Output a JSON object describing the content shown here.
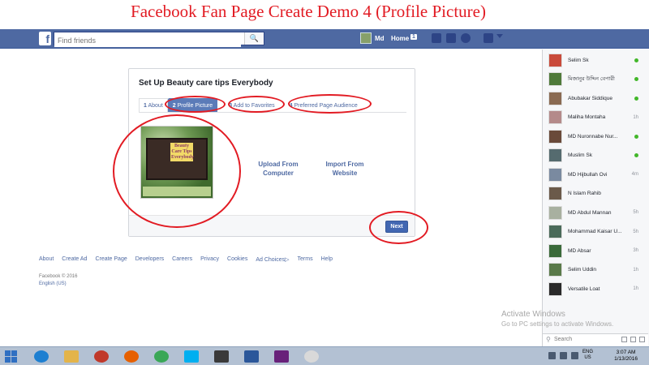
{
  "overlay_title": "Facebook Fan Page Create Demo 4 (Profile Picture)",
  "topbar": {
    "logo": "f",
    "search_placeholder": "Find friends",
    "user_name": "Md",
    "home_label": "Home",
    "home_count": "1"
  },
  "setup_card": {
    "title": "Set Up Beauty care tips Everybody",
    "tabs": [
      {
        "num": "1",
        "label": "About"
      },
      {
        "num": "2",
        "label": "Profile Picture"
      },
      {
        "num": "3",
        "label": "Add to Favorites"
      },
      {
        "num": "4",
        "label": "Preferred Page Audience"
      }
    ],
    "active_tab": 1,
    "picture_text": "Beauty\nCare Tips\nEverybody",
    "upload_label": "Upload From\nComputer",
    "import_label": "Import From\nWebsite",
    "next_label": "Next"
  },
  "footer": {
    "links": [
      "About",
      "Create Ad",
      "Create Page",
      "Developers",
      "Careers",
      "Privacy",
      "Cookies",
      "Ad Choices",
      "Terms",
      "Help"
    ],
    "copyright": "Facebook © 2016",
    "language": "English (US)"
  },
  "chat": {
    "contacts": [
      {
        "name": "Selim Sk",
        "status": "online",
        "color": "#c94a3b"
      },
      {
        "name": "মিজানুর উদ্দিন বেপারী",
        "status": "online",
        "color": "#4f7a3a"
      },
      {
        "name": "Abubakar Siddique",
        "status": "online",
        "color": "#8a6a52"
      },
      {
        "name": "Maliha Montaha",
        "status": "1h",
        "color": "#b48a8a"
      },
      {
        "name": "MD Nuronnabe Nur...",
        "status": "online",
        "color": "#6a4a3a"
      },
      {
        "name": "Muslim Sk",
        "status": "online",
        "color": "#556b6f"
      },
      {
        "name": "MD Hijbullah Ovi",
        "status": "4m",
        "color": "#7a8aa0"
      },
      {
        "name": "N Islam Rahib",
        "status": "",
        "color": "#6b5a4a"
      },
      {
        "name": "MD Abdul Mannan",
        "status": "5h",
        "color": "#a8b0a0"
      },
      {
        "name": "Mohammad Kaisar U...",
        "status": "5h",
        "color": "#4a6a5a"
      },
      {
        "name": "MD Absar",
        "status": "3h",
        "color": "#3a6a3a"
      },
      {
        "name": "Selim Uddin",
        "status": "1h",
        "color": "#5a7a4a"
      },
      {
        "name": "Versatile Loat",
        "status": "1h",
        "color": "#2a2a2a"
      }
    ],
    "search_label": "Search"
  },
  "watermark": {
    "title": "Activate Windows",
    "subtitle": "Go to PC settings to activate Windows."
  },
  "taskbar": {
    "lang_top": "ENG",
    "lang_bottom": "US",
    "time": "3:07 AM",
    "date": "1/13/2016",
    "apps": [
      "ie",
      "explorer",
      "chrome-alt",
      "firefox",
      "chrome",
      "skype",
      "3g",
      "word",
      "vs",
      "paint"
    ]
  }
}
